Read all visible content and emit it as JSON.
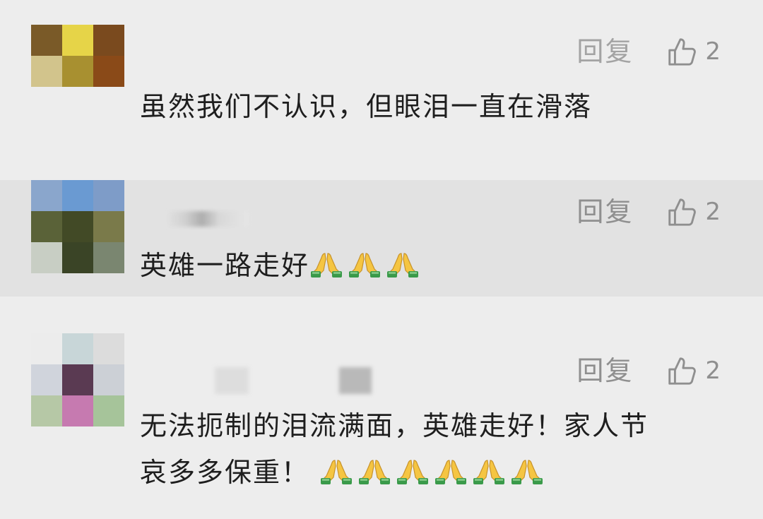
{
  "comments": [
    {
      "text": "虽然我们不认识，但眼泪一直在滑落",
      "reply_label": "回复",
      "likes": "2",
      "emoji_count": 0,
      "avatar_colors": [
        "#7a5a28",
        "#e6d448",
        "#7a4a1e",
        "#d2c48c",
        "#a89030",
        "#8a4a18"
      ]
    },
    {
      "text": "英雄一路走好",
      "reply_label": "回复",
      "likes": "2",
      "emoji_count": 3,
      "avatar_colors": [
        "#8aa6cc",
        "#6a9ad2",
        "#7e9cc8",
        "#5a6238",
        "#424a26",
        "#7a7a4a",
        "#c8cec4",
        "#3a4426",
        "#7a8670"
      ]
    },
    {
      "text_line1": "无法扼制的泪流满面，英雄走好！家人节",
      "text_line2": "哀多多保重！",
      "reply_label": "回复",
      "likes": "2",
      "emoji_count": 6,
      "avatar_colors": [
        "#ececec",
        "#c8d6d8",
        "#dcdcdc",
        "#d0d4dc",
        "#5a3a52",
        "#ccd0d6",
        "#b6c8a6",
        "#c67ab0",
        "#a6c49a"
      ]
    }
  ],
  "icons": {
    "like": "thumbs-up-outline",
    "emoji": "folded-hands"
  },
  "colors": {
    "background": "#ededed",
    "highlight_row": "#e2e2e2",
    "text": "#1e1e1e",
    "muted": "#8f8f8f"
  }
}
